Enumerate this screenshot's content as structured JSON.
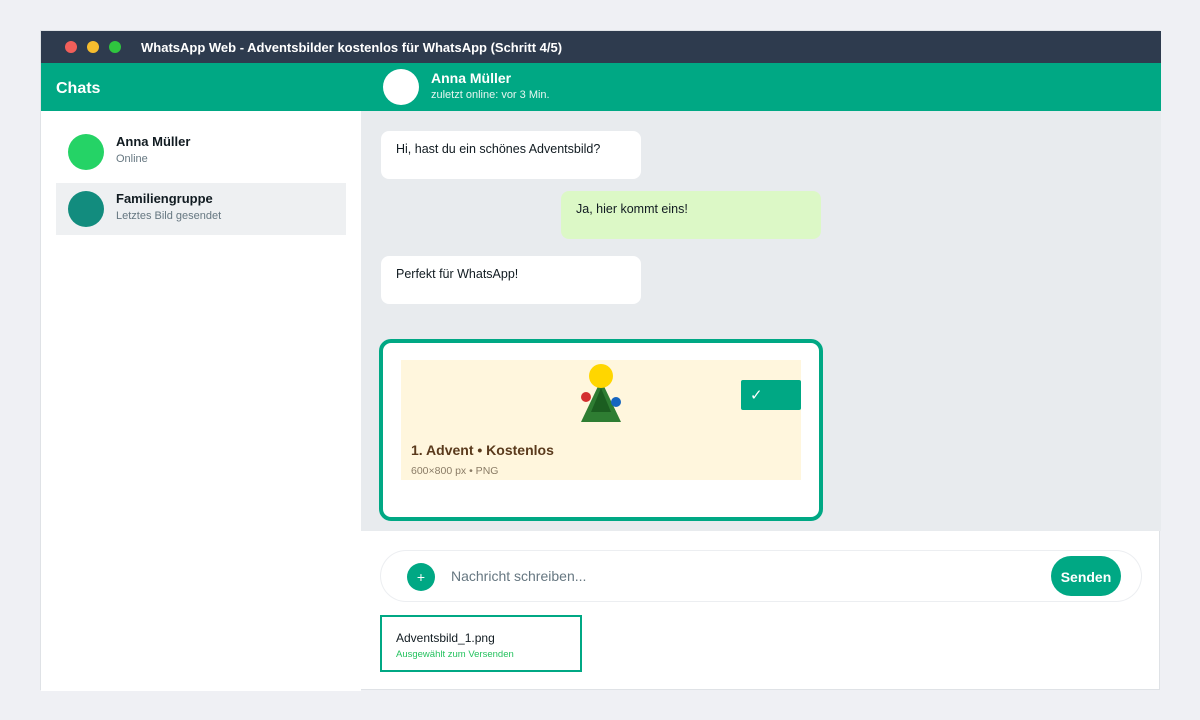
{
  "window": {
    "title": "WhatsApp Web - Adventsbilder kostenlos für WhatsApp (Schritt 4/5)"
  },
  "sidebar": {
    "header": "Chats",
    "chats": [
      {
        "name": "Anna Müller",
        "status": "Online",
        "avatar_color": "#25d366",
        "selected": true
      },
      {
        "name": "Familiengruppe",
        "status": "Letztes Bild gesendet",
        "avatar_color": "#128c7e",
        "selected": false
      }
    ]
  },
  "chat_header": {
    "name": "Anna Müller",
    "status": "zuletzt online: vor 3 Min."
  },
  "messages": [
    {
      "direction": "incoming",
      "text": "Hi, hast du ein schönes Adventsbild?"
    },
    {
      "direction": "outgoing",
      "text": "Ja, hier kommt eins!"
    },
    {
      "direction": "incoming",
      "text": "Perfekt für WhatsApp!"
    }
  ],
  "image_card": {
    "title": "1. Advent • Kostenlos",
    "meta": "600×800 px • PNG",
    "check_label": "✓"
  },
  "composer": {
    "attach_label": "+",
    "placeholder": "Nachricht schreiben...",
    "send_label": "Senden"
  },
  "attachment": {
    "filename": "Adventsbild_1.png",
    "status": "Ausgewählt zum Versenden"
  },
  "colors": {
    "accent": "#00a884",
    "titlebar": "#2e3b4e",
    "outgoing_bubble": "#dcf8c6",
    "chat_background": "#e8ebee",
    "selected_status": "#25c25f"
  }
}
